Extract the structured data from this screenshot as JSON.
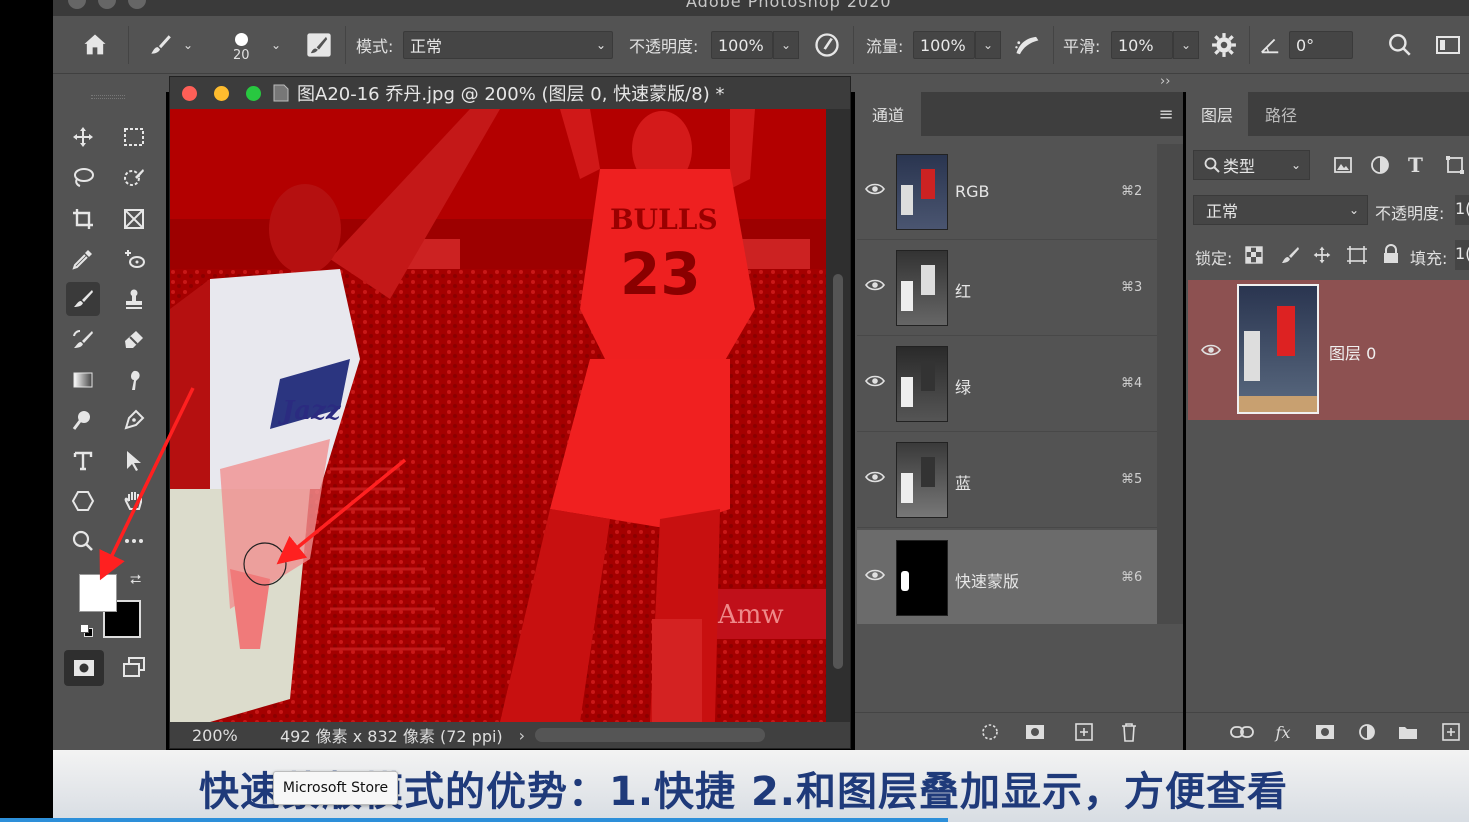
{
  "window": {
    "title": "Adobe Photoshop 2020"
  },
  "options_bar": {
    "brush_size": "20",
    "mode_label": "模式:",
    "mode_value": "正常",
    "opacity_label": "不透明度:",
    "opacity_value": "100%",
    "flow_label": "流量:",
    "flow_value": "100%",
    "smoothing_label": "平滑:",
    "smoothing_value": "10%",
    "angle_value": "0°"
  },
  "collapse": {
    "left": "‹‹",
    "right": "››"
  },
  "document": {
    "tab_title": "图A20-16 乔丹.jpg @ 200% (图层 0, 快速蒙版/8) *",
    "zoom": "200%",
    "size_info": "492 像素 x 832 像素 (72 ppi)",
    "jersey_team": "BULLS",
    "jersey_number": "23",
    "ad_text": "Amw"
  },
  "channels_panel": {
    "tab_channels": "通道",
    "tab_menu": "≡",
    "channels": [
      {
        "name": "RGB",
        "shortcut": "⌘2"
      },
      {
        "name": "红",
        "shortcut": "⌘3"
      },
      {
        "name": "绿",
        "shortcut": "⌘4"
      },
      {
        "name": "蓝",
        "shortcut": "⌘5"
      },
      {
        "name": "快速蒙版",
        "shortcut": "⌘6"
      }
    ]
  },
  "layers_panel": {
    "tab_layers": "图层",
    "tab_paths": "路径",
    "filter_kind": "类型",
    "blend_mode": "正常",
    "opacity_label": "不透明度:",
    "opacity_value": "1(",
    "lock_label": "锁定:",
    "fill_label": "填充:",
    "fill_value": "1(",
    "layer_name": "图层 0"
  },
  "subtitle": {
    "text": "快速蒙版模式的优势：1.快捷 2.和图层叠加显示，方便查看"
  },
  "tooltip": {
    "text": "Microsoft Store"
  },
  "colors": {
    "accent_red": "#b80000",
    "panel_bg": "#535353",
    "subtitle_text": "#1f3a7a"
  }
}
